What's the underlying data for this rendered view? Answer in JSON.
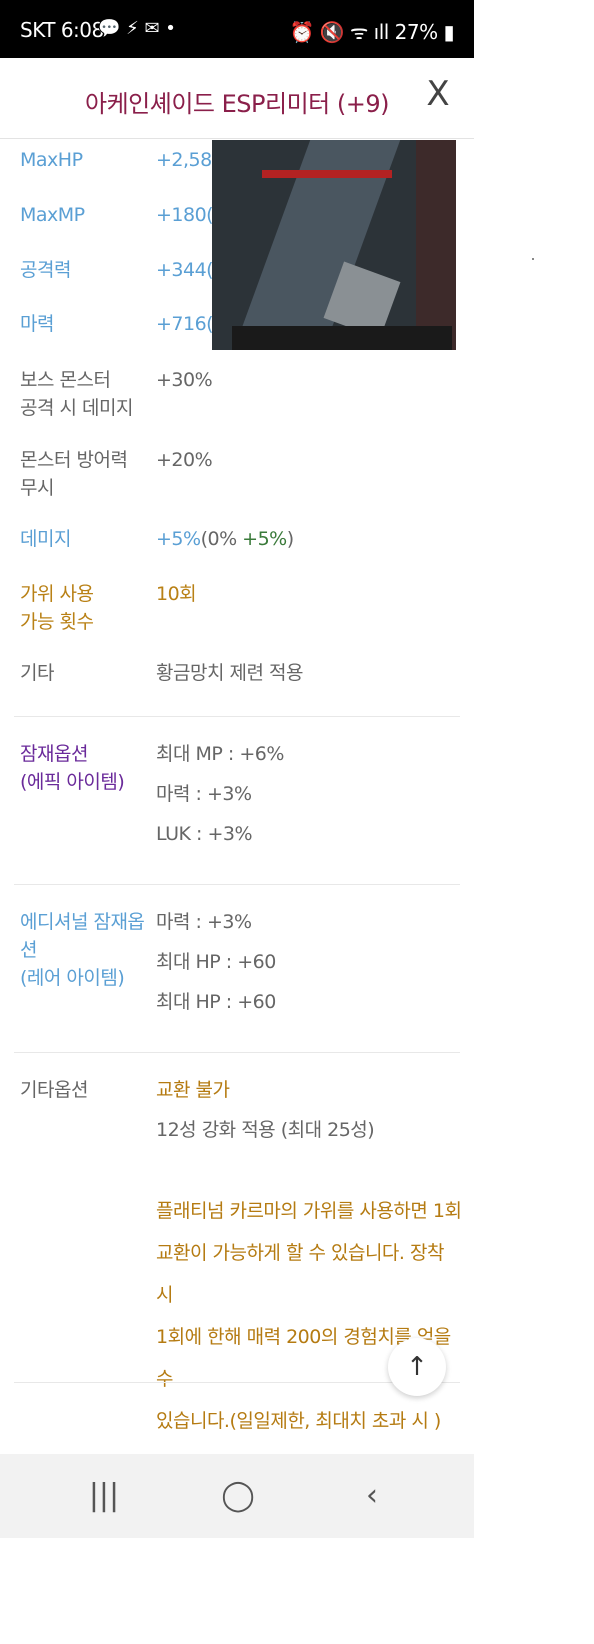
{
  "status_bar": {
    "carrier_time": "SKT 6:08",
    "left_icons": "💬 ⚡ ✉ •",
    "right_icons": "⏰ 🔇 ᯤ ıll",
    "battery": "27%"
  },
  "header": {
    "title": "아케인셰이드 ESP리미터 (+9)",
    "close_symbol": "X"
  },
  "stats": [
    {
      "label": "MaxHP",
      "value": "+2,580"
    },
    {
      "label": "MaxMP",
      "value": "+180(0"
    },
    {
      "label": "공격력",
      "value": "+344(2"
    },
    {
      "label": "마력",
      "value": "+716(3"
    }
  ],
  "boss": {
    "label_line1": "보스 몬스터",
    "label_line2": "공격 시 데미지",
    "value": "+30%"
  },
  "ignore_def": {
    "label_line1": "몬스터 방어력",
    "label_line2": "무시",
    "value": "+20%"
  },
  "damage": {
    "label": "데미지",
    "value_main": "+5%",
    "value_paren_start": "(0% ",
    "value_green": "+5%",
    "value_paren_end": ")"
  },
  "scissors": {
    "label_line1": "가위 사용",
    "label_line2": "가능 횟수",
    "value": "10회"
  },
  "etc": {
    "label": "기타",
    "value": "황금망치 제련 적용"
  },
  "potential": {
    "label_line1": "잠재옵션",
    "label_line2": "(에픽 아이템)",
    "options": [
      "최대 MP : +6%",
      "마력 : +3%",
      "LUK : +3%"
    ]
  },
  "additional": {
    "label_line1": "에디셔널 잠재옵션",
    "label_line2": "(레어 아이템)",
    "options": [
      "마력 : +3%",
      "최대 HP : +60",
      "최대 HP : +60"
    ]
  },
  "other_options": {
    "label": "기타옵션",
    "trade": "교환 불가",
    "star": "12성 강화 적용 (최대 25성)",
    "desc_lines": [
      "플래티넘 카르마의 가위를 사용하면 1회",
      "교환이 가능하게 할 수 있습니다. 장착 시",
      "1회에 한해 매력 200의 경험치를 얻을 수",
      "있습니다.(일일제한, 최대치 초과 시    )"
    ]
  },
  "fab": {
    "symbol": "↑"
  },
  "navbar": {
    "recent": "|||",
    "home": "◯",
    "back": "‹"
  }
}
